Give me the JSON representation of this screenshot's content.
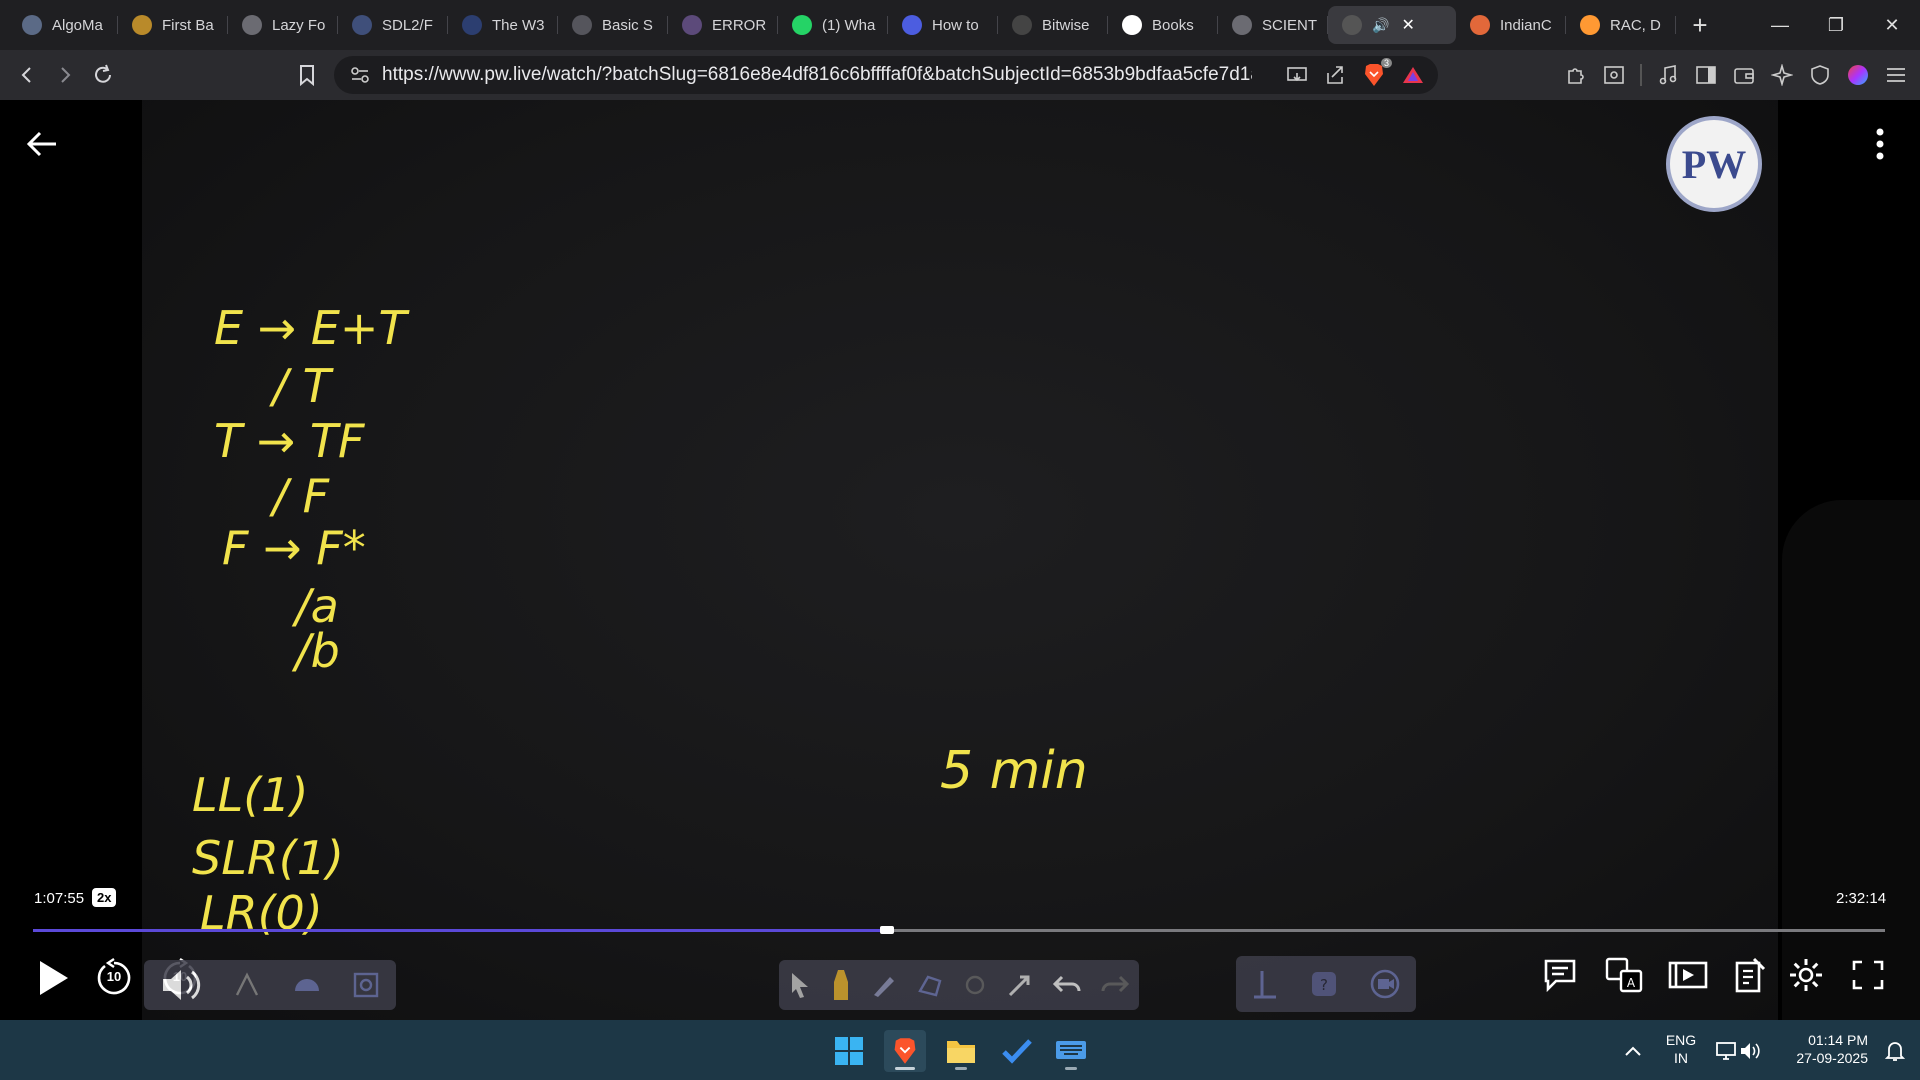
{
  "browser": {
    "tabs": [
      {
        "label": "AlgoMa",
        "favicon": "algomaster-icon",
        "color": "#5b6a86"
      },
      {
        "label": "First Ba",
        "favicon": "stairs-icon",
        "color": "#b98a2a"
      },
      {
        "label": "Lazy Fo",
        "favicon": "globe-icon",
        "color": "#6b6b72"
      },
      {
        "label": "SDL2/F",
        "favicon": "sdl-icon",
        "color": "#3f4f7a"
      },
      {
        "label": "The W3",
        "favicon": "w3-icon",
        "color": "#2c3e70"
      },
      {
        "label": "Basic S",
        "favicon": "markdown-icon",
        "color": "#55555c"
      },
      {
        "label": "ERROR",
        "favicon": "planet-icon",
        "color": "#5c4a7a"
      },
      {
        "label": "(1) Wha",
        "favicon": "whatsapp-icon",
        "color": "#25d366"
      },
      {
        "label": "How to",
        "favicon": "bookmark-blue-icon",
        "color": "#4c5de0"
      },
      {
        "label": "Bitwise",
        "favicon": "code-icon",
        "color": "#444"
      },
      {
        "label": "Books",
        "favicon": "google-icon",
        "color": "#ffffff"
      },
      {
        "label": "SCIENT",
        "favicon": "globe-icon",
        "color": "#6b6b72"
      },
      {
        "label": "",
        "favicon": "pw-icon",
        "color": "#555",
        "active": true
      },
      {
        "label": "IndianC",
        "favicon": "india-food-icon",
        "color": "#e2683a"
      },
      {
        "label": "RAC, D",
        "favicon": "india-flag-icon",
        "color": "#ff9933"
      }
    ],
    "url": "https://www.pw.live/watch/?batchSlug=6816e8e4df816c6bffffaf0f&batchSubjectId=6853b9bdfaa5cfe7d1a62c0...",
    "brave_badge": "3"
  },
  "video": {
    "board_lines": [
      "E → E+T",
      "    / T",
      "T → TF",
      "    / F",
      "F → F*",
      "     /a",
      "     /b"
    ],
    "parsers": [
      "LL(1)",
      "SLR(1)",
      "LR(0)"
    ],
    "note": "5 min",
    "time_current": "1:07:55",
    "time_total": "2:32:14",
    "speed": "2x",
    "progress": 0.4609,
    "logo": "PW",
    "skip_back": "10",
    "skip_forward": "10"
  },
  "taskbar": {
    "lang_top": "ENG",
    "lang_bottom": "IN",
    "time": "01:14 PM",
    "date": "27-09-2025"
  }
}
